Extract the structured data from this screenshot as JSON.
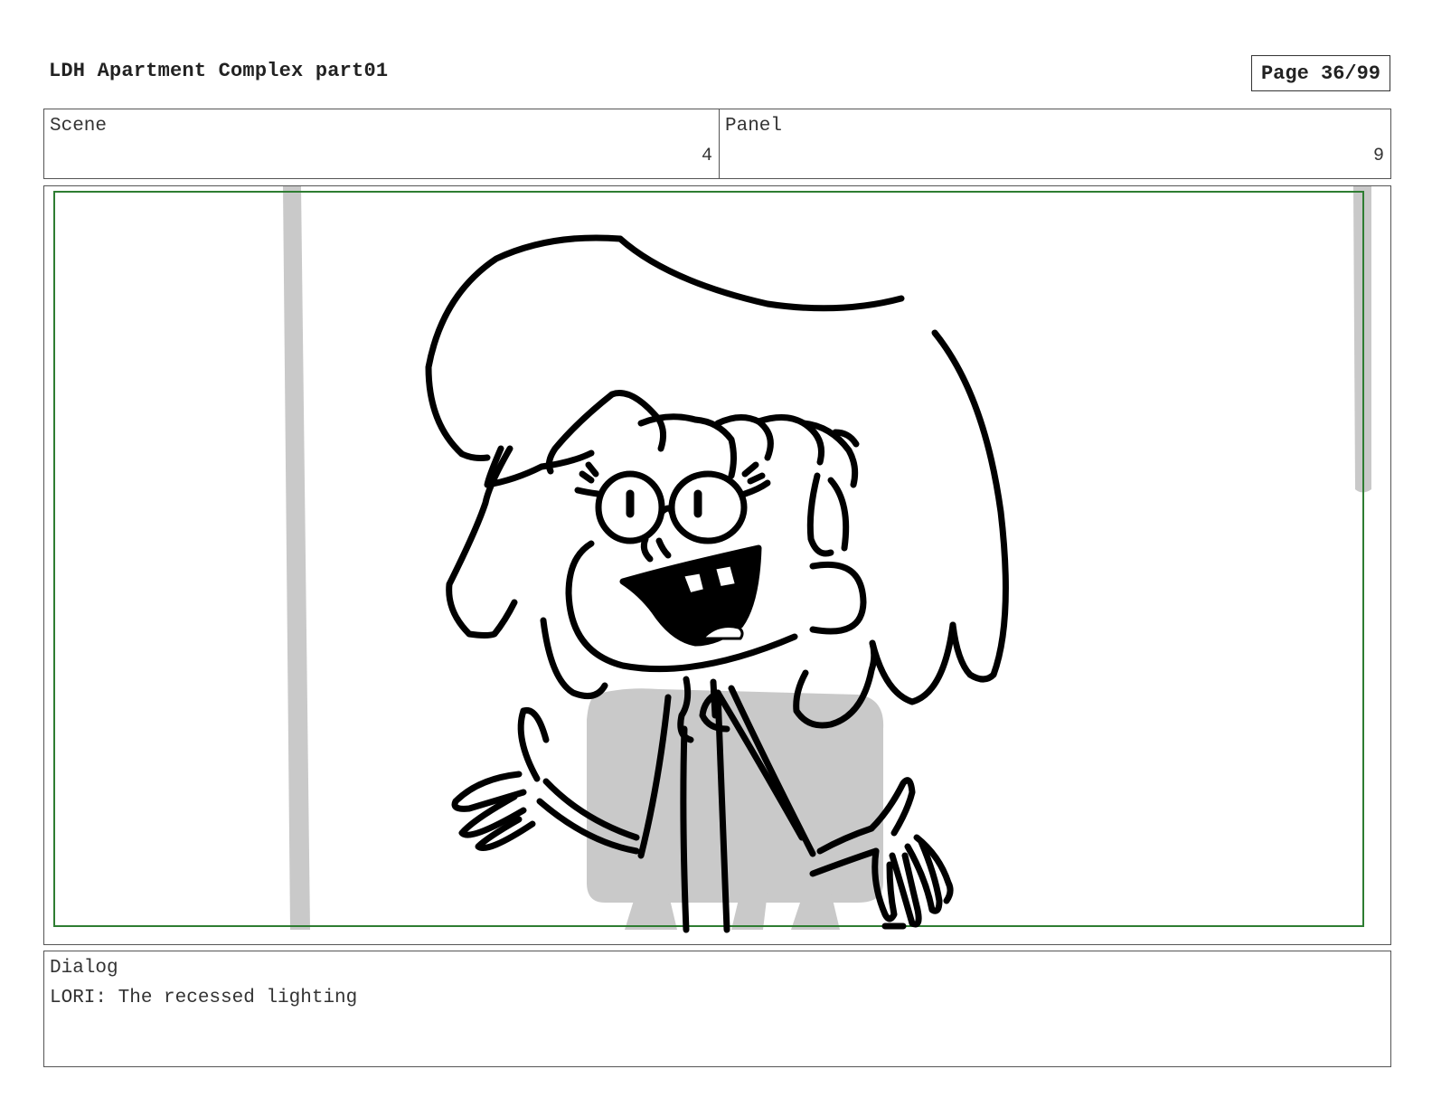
{
  "header": {
    "title": "LDH Apartment Complex part01",
    "page": "Page 36/99"
  },
  "info": {
    "scene_label": "Scene",
    "scene_value": "4",
    "panel_label": "Panel",
    "panel_value": "9"
  },
  "dialog": {
    "label": "Dialog",
    "text": "LORI: The recessed lighting"
  },
  "colors": {
    "frame_safe_area": "#2e7d32",
    "sketch_gray": "#c8c8c8",
    "ink": "#000000"
  }
}
